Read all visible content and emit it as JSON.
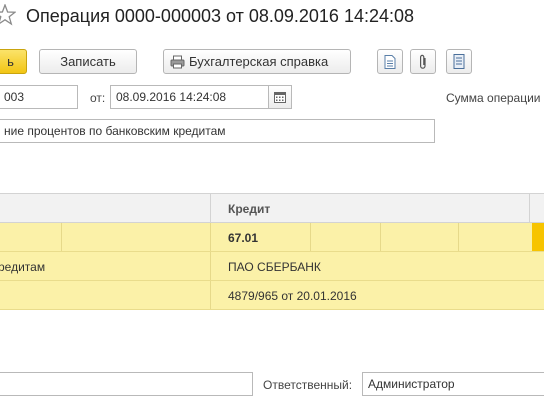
{
  "window": {
    "title": "Операция 0000-000003 от 08.09.2016 14:24:08"
  },
  "toolbar": {
    "primary_label": "ь",
    "save_label": "Записать",
    "report_label": "Бухгалтерская справка",
    "icons": [
      "document-icon",
      "paperclip-icon",
      "list-icon"
    ]
  },
  "form": {
    "number_value": "003",
    "date_label": "от:",
    "date_value": "08.09.2016 14:24:08",
    "sum_label": "Сумма операции",
    "description_value": "ние процентов по банковским кредитам",
    "responsible_label": "Ответственный:",
    "responsible_value": "Администратор"
  },
  "table": {
    "columns": [
      "",
      "Кредит"
    ],
    "rows": [
      {
        "debit": "",
        "credit": "67.01"
      },
      {
        "debit": "редитам",
        "credit": "ПАО СБЕРБАНК"
      },
      {
        "debit": "",
        "credit": "4879/965 от 20.01.2016"
      }
    ]
  },
  "colors": {
    "primary_button": "#f2c514",
    "row_highlight": "#fbf1a8",
    "selection_marker": "#f7c400"
  }
}
